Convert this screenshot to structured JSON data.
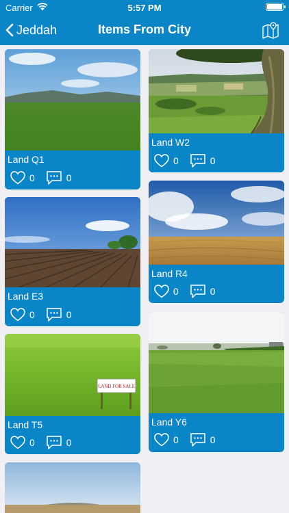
{
  "status": {
    "carrier": "Carrier",
    "time": "5:57 PM"
  },
  "nav": {
    "back_label": "Jeddah",
    "title": "Items From City"
  },
  "items": [
    {
      "name": "Land Q1",
      "likes": "0",
      "comments": "0"
    },
    {
      "name": "Land W2",
      "likes": "0",
      "comments": "0"
    },
    {
      "name": "Land E3",
      "likes": "0",
      "comments": "0"
    },
    {
      "name": "Land R4",
      "likes": "0",
      "comments": "0"
    },
    {
      "name": "Land T5",
      "likes": "0",
      "comments": "0",
      "sign_text": "LAND FOR SALE"
    },
    {
      "name": "Land Y6",
      "likes": "0",
      "comments": "0"
    }
  ],
  "colors": {
    "accent": "#0a86c8",
    "background": "#efeff4"
  }
}
